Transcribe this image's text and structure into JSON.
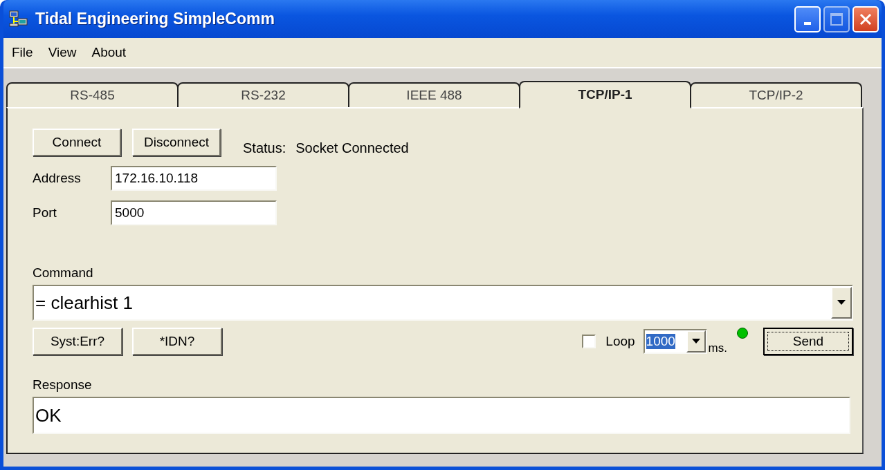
{
  "window": {
    "title": "Tidal Engineering SimpleComm"
  },
  "menu": [
    "File",
    "View",
    "About"
  ],
  "tabs": [
    {
      "label": "RS-485",
      "selected": false
    },
    {
      "label": "RS-232",
      "selected": false
    },
    {
      "label": "IEEE 488",
      "selected": false
    },
    {
      "label": "TCP/IP-1",
      "selected": true
    },
    {
      "label": "TCP/IP-2",
      "selected": false
    }
  ],
  "connection": {
    "buttons": [
      "Connect",
      "Disconnect"
    ],
    "status_label": "Status:",
    "status": "Socket Connected"
  },
  "fields": [
    {
      "label": "Address",
      "value": "172.16.10.118"
    },
    {
      "label": "Port",
      "value": "5000"
    }
  ],
  "command": {
    "label": "Command",
    "value": "= clearhist 1"
  },
  "quick_buttons": [
    "Syst:Err?",
    "*IDN?"
  ],
  "loop": {
    "label": "Loop",
    "checked": false,
    "interval": "1000",
    "unit": "ms.",
    "color": "#00c000"
  },
  "send_button": "Send",
  "response": {
    "label": "Response",
    "value": "OK"
  }
}
